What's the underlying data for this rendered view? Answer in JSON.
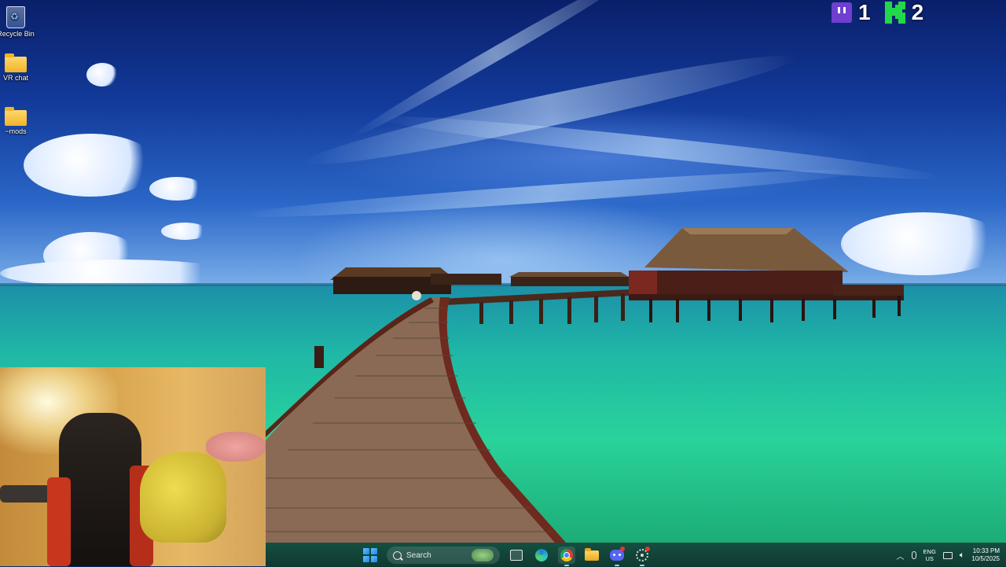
{
  "desktop": {
    "icons": [
      {
        "label": "Recycle Bin",
        "icon": "recycle-bin-icon"
      },
      {
        "label": "VR chat",
        "icon": "folder-icon"
      },
      {
        "label": "~mods",
        "icon": "folder-icon"
      }
    ]
  },
  "overlay": {
    "twitch_icon": "twitch-icon",
    "twitch_count": "1",
    "kick_icon": "kick-icon",
    "kick_count": "2",
    "twitch_color": "#6f3fd0",
    "kick_color": "#22d84a"
  },
  "taskbar": {
    "start_icon": "windows-start-icon",
    "search_placeholder": "Search",
    "apps": [
      "task-view-icon",
      "edge-icon",
      "chrome-icon",
      "file-explorer-icon",
      "discord-icon",
      "settings-icon"
    ],
    "tray": {
      "lang_line1": "ENG",
      "lang_line2": "US",
      "time": "10:33 PM",
      "date": "10/5/2025"
    }
  }
}
